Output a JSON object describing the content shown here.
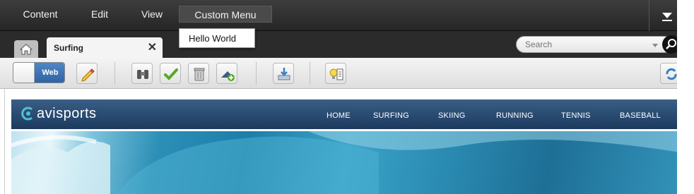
{
  "menubar": {
    "items": [
      "Content",
      "Edit",
      "View",
      "Custom Menu"
    ],
    "active_index": 3
  },
  "dropdown": {
    "items": [
      "Hello World"
    ]
  },
  "tabs": {
    "doc_tab_label": "Surfing",
    "close_glyph": "✕"
  },
  "search": {
    "placeholder": "Search"
  },
  "toolbar": {
    "view_toggle_label": "Web"
  },
  "site": {
    "logo_text": "avisports",
    "nav": [
      "HOME",
      "SURFING",
      "SKIING",
      "RUNNING",
      "TENNIS",
      "BASEBALL"
    ]
  }
}
